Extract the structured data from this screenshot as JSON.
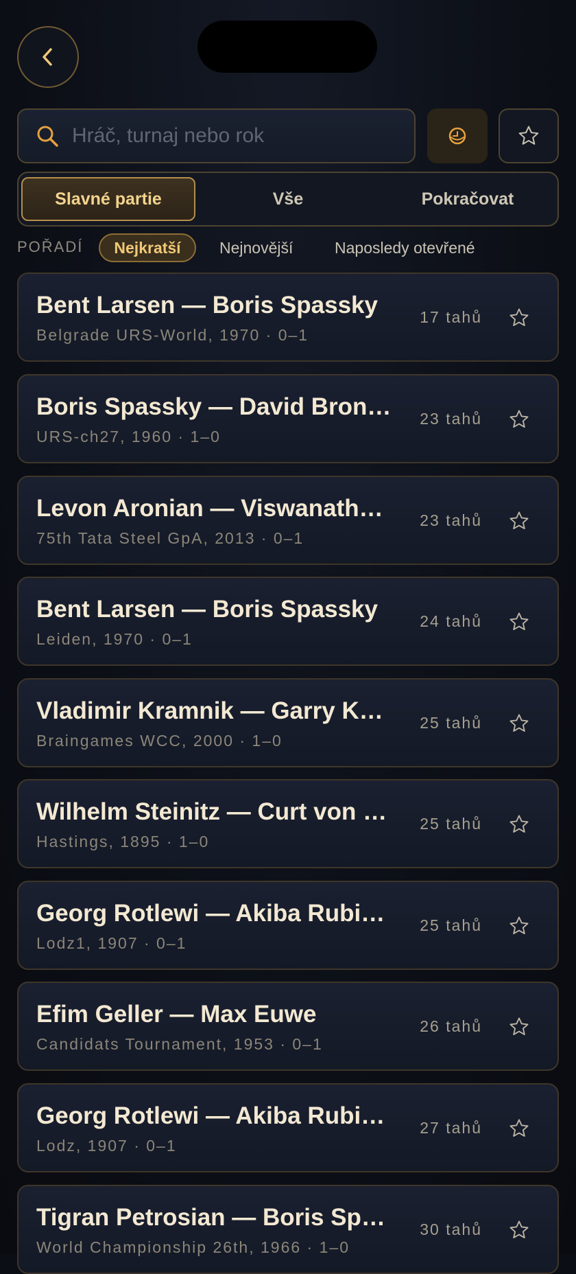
{
  "search": {
    "placeholder": "Hráč, turnaj nebo rok",
    "value": ""
  },
  "tabs": [
    {
      "label": "Slavné partie",
      "active": true
    },
    {
      "label": "Vše",
      "active": false
    },
    {
      "label": "Pokračovat",
      "active": false
    }
  ],
  "sort": {
    "label": "POŘADÍ",
    "options": [
      {
        "label": "Nejkratší",
        "active": true
      },
      {
        "label": "Nejnovější",
        "active": false
      },
      {
        "label": "Naposledy otevřené",
        "active": false
      }
    ]
  },
  "games": [
    {
      "title": "Bent Larsen — Boris Spassky",
      "subtitle": "Belgrade URS-World, 1970 · 0–1",
      "moves": "17 tahů"
    },
    {
      "title": "Boris Spassky — David Bronstein",
      "subtitle": "URS-ch27, 1960 · 1–0",
      "moves": "23 tahů"
    },
    {
      "title": "Levon Aronian — Viswanathan Anand",
      "subtitle": "75th Tata Steel GpA, 2013 · 0–1",
      "moves": "23 tahů"
    },
    {
      "title": "Bent Larsen — Boris Spassky",
      "subtitle": "Leiden, 1970 · 0–1",
      "moves": "24 tahů"
    },
    {
      "title": "Vladimir Kramnik — Garry Kasparov",
      "subtitle": "Braingames WCC, 2000 · 1–0",
      "moves": "25 tahů"
    },
    {
      "title": "Wilhelm Steinitz — Curt von Bardeleben",
      "subtitle": "Hastings, 1895 · 1–0",
      "moves": "25 tahů"
    },
    {
      "title": "Georg Rotlewi — Akiba Rubinstein",
      "subtitle": "Lodz1, 1907 · 0–1",
      "moves": "25 tahů"
    },
    {
      "title": "Efim Geller — Max Euwe",
      "subtitle": "Candidats Tournament, 1953 · 0–1",
      "moves": "26 tahů"
    },
    {
      "title": "Georg Rotlewi — Akiba Rubinstein",
      "subtitle": "Lodz, 1907 · 0–1",
      "moves": "27 tahů"
    },
    {
      "title": "Tigran Petrosian — Boris Spassky",
      "subtitle": "World Championship 26th, 1966 · 1–0",
      "moves": "30 tahů"
    }
  ],
  "colors": {
    "accent": "#f3d48e",
    "background": "#0c0f16"
  }
}
